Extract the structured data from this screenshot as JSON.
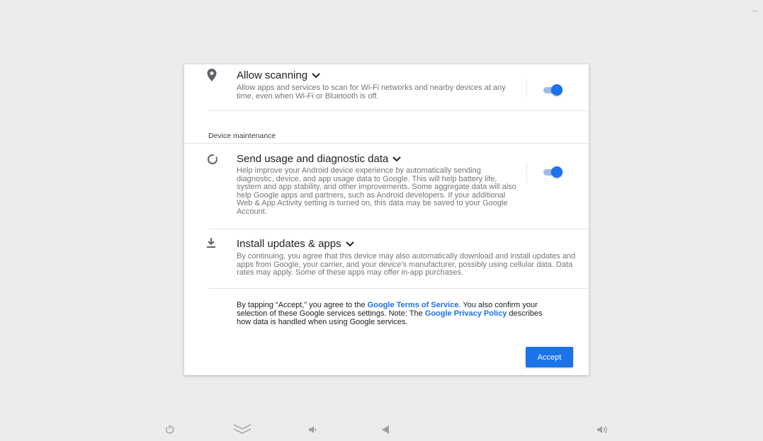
{
  "window": {
    "resize_glyph": "↔"
  },
  "dialog": {
    "scanning": {
      "title": "Allow scanning",
      "desc": "Allow apps and services to scan for Wi-Fi networks and nearby devices at any time, even when Wi-Fi or Bluetooth is off.",
      "enabled": true
    },
    "section_label": "Device maintenance",
    "usage": {
      "title": "Send usage and diagnostic data",
      "desc": "Help improve your Android device experience by automatically sending diagnostic, device, and app usage data to Google. This will help battery life, system and app stability, and other improvements. Some aggregate data will also help Google apps and partners, such as Android developers. If your additional Web & App Activity setting is turned on, this data may be saved to your Google Account.",
      "enabled": true
    },
    "updates": {
      "title": "Install updates & apps",
      "desc": "By continuing, you agree that this device may also automatically download and install updates and apps from Google, your carrier, and your device's manufacturer, possibly using cellular data. Data rates may apply. Some of these apps may offer in-app purchases."
    },
    "footer": {
      "part1": "By tapping “Accept,” you agree to the ",
      "tos_link": "Google Terms of Service",
      "part2": ". You also confirm your selection of these Google services settings. Note: The ",
      "privacy_link": "Google Privacy Policy",
      "part3": " describes how data is handled when using Google services."
    },
    "accept_label": "Accept"
  },
  "navbar": {
    "icons": [
      "power-icon",
      "keyboard-hide-icon",
      "volume-down-icon",
      "back-icon",
      "volume-up-icon"
    ]
  },
  "colors": {
    "accent": "#1a73e8",
    "background": "#ececec"
  }
}
